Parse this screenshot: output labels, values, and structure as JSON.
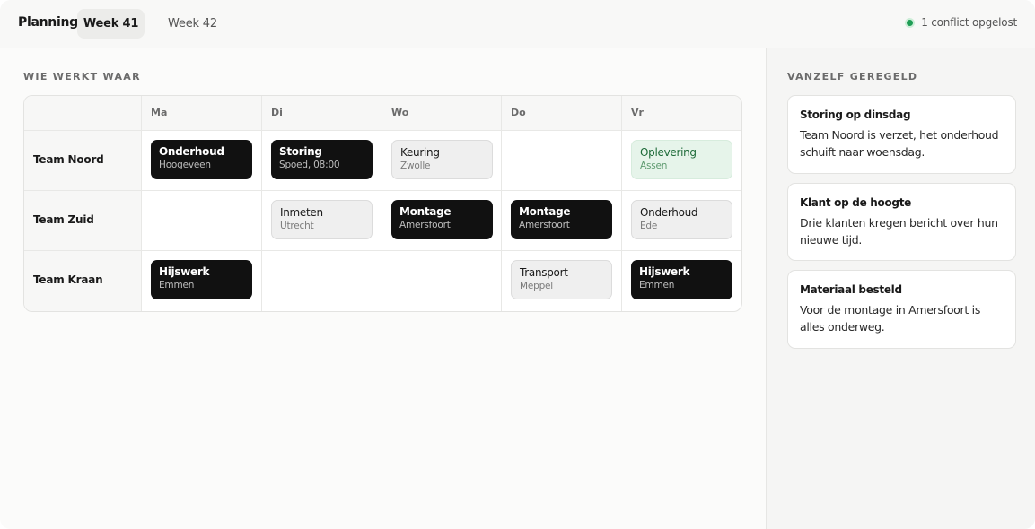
{
  "header": {
    "brand": "Planning",
    "tabs": [
      {
        "label": "Week 41",
        "active": true
      },
      {
        "label": "Week 42",
        "active": false
      }
    ],
    "status": "1 conflict opgelost",
    "status_color": "#1f9d55"
  },
  "schedule": {
    "title": "WIE WERKT WAAR",
    "days": [
      "Ma",
      "Di",
      "Wo",
      "Do",
      "Vr"
    ],
    "rows": [
      {
        "team": "Team Noord",
        "cells": [
          {
            "title": "Onderhoud",
            "sub": "Hoogeveen",
            "style": "dark"
          },
          {
            "title": "Storing",
            "sub": "Spoed, 08:00",
            "style": "dark"
          },
          {
            "title": "Keuring",
            "sub": "Zwolle",
            "style": "light"
          },
          null,
          {
            "title": "Oplevering",
            "sub": "Assen",
            "style": "green"
          }
        ]
      },
      {
        "team": "Team Zuid",
        "cells": [
          null,
          {
            "title": "Inmeten",
            "sub": "Utrecht",
            "style": "light"
          },
          {
            "title": "Montage",
            "sub": "Amersfoort",
            "style": "dark"
          },
          {
            "title": "Montage",
            "sub": "Amersfoort",
            "style": "dark"
          },
          {
            "title": "Onderhoud",
            "sub": "Ede",
            "style": "light"
          }
        ]
      },
      {
        "team": "Team Kraan",
        "cells": [
          {
            "title": "Hijswerk",
            "sub": "Emmen",
            "style": "dark"
          },
          null,
          null,
          {
            "title": "Transport",
            "sub": "Meppel",
            "style": "light"
          },
          {
            "title": "Hijswerk",
            "sub": "Emmen",
            "style": "dark"
          }
        ]
      }
    ]
  },
  "sidebar": {
    "title": "VANZELF GEREGELD",
    "cards": [
      {
        "title": "Storing op dinsdag",
        "body": "Team Noord is verzet, het onderhoud schuift naar woensdag."
      },
      {
        "title": "Klant op de hoogte",
        "body": "Drie klanten kregen bericht over hun nieuwe tijd."
      },
      {
        "title": "Materiaal besteld",
        "body": "Voor de montage in Amersfoort is alles onderweg."
      }
    ]
  }
}
